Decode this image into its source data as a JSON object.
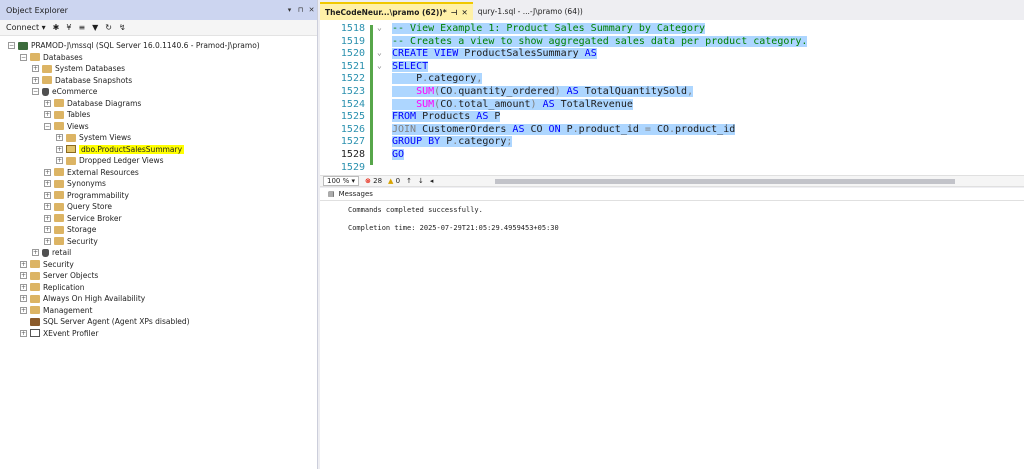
{
  "object_explorer": {
    "title": "Object Explorer",
    "controls": [
      "▾",
      "⊓",
      "✕"
    ],
    "toolbar": {
      "connect": "Connect ▾",
      "icons": [
        "✱",
        "¥",
        "≡",
        "▼",
        "↻",
        "↯"
      ]
    },
    "tree": [
      {
        "label": "PRAMOD-J\\mssql (SQL Server 16.0.1140.6 - Pramod-J\\pramo)",
        "exp": "−",
        "icon": "server"
      },
      {
        "label": "Databases",
        "exp": "−",
        "icon": "folder"
      },
      {
        "label": "System Databases",
        "exp": "+",
        "icon": "folder"
      },
      {
        "label": "Database Snapshots",
        "exp": "+",
        "icon": "folder"
      },
      {
        "label": "eCommerce",
        "exp": "−",
        "icon": "db"
      },
      {
        "label": "Database Diagrams",
        "exp": "+",
        "icon": "folder"
      },
      {
        "label": "Tables",
        "exp": "+",
        "icon": "folder"
      },
      {
        "label": "Views",
        "exp": "−",
        "icon": "folder"
      },
      {
        "label": "System Views",
        "exp": "+",
        "icon": "folder"
      },
      {
        "label": "dbo.ProductSalesSummary",
        "exp": "+",
        "icon": "view"
      },
      {
        "label": "Dropped Ledger Views",
        "exp": "+",
        "icon": "folder"
      },
      {
        "label": "External Resources",
        "exp": "+",
        "icon": "folder"
      },
      {
        "label": "Synonyms",
        "exp": "+",
        "icon": "folder"
      },
      {
        "label": "Programmability",
        "exp": "+",
        "icon": "folder"
      },
      {
        "label": "Query Store",
        "exp": "+",
        "icon": "folder"
      },
      {
        "label": "Service Broker",
        "exp": "+",
        "icon": "folder"
      },
      {
        "label": "Storage",
        "exp": "+",
        "icon": "folder"
      },
      {
        "label": "Security",
        "exp": "+",
        "icon": "folder"
      },
      {
        "label": "retail",
        "exp": "+",
        "icon": "db"
      },
      {
        "label": "Security",
        "exp": "+",
        "icon": "folder"
      },
      {
        "label": "Server Objects",
        "exp": "+",
        "icon": "folder"
      },
      {
        "label": "Replication",
        "exp": "+",
        "icon": "folder"
      },
      {
        "label": "Always On High Availability",
        "exp": "+",
        "icon": "folder"
      },
      {
        "label": "Management",
        "exp": "+",
        "icon": "folder"
      },
      {
        "label": "SQL Server Agent (Agent XPs disabled)",
        "exp": "",
        "icon": "agent"
      },
      {
        "label": "XEvent Profiler",
        "exp": "+",
        "icon": "xevent"
      }
    ]
  },
  "tabs": [
    {
      "label": "TheCodeNeur...\\pramo (62))*",
      "pin": "⊣",
      "close": "✕"
    },
    {
      "label": "qury-1.sql - ...-J\\pramo (64))"
    }
  ],
  "editor": {
    "lines": [
      {
        "n": "1518",
        "fold": "⌄",
        "segs": [
          [
            "cm",
            "-- View Example 1: Product Sales Summary by Category"
          ]
        ]
      },
      {
        "n": "1519",
        "fold": "",
        "segs": [
          [
            "cm",
            "-- Creates a view to show aggregated sales data per product category."
          ]
        ]
      },
      {
        "n": "1520",
        "fold": "⌄",
        "segs": [
          [
            "kw",
            "CREATE VIEW "
          ],
          [
            "",
            "ProductSalesSummary "
          ],
          [
            "kw",
            "AS"
          ]
        ]
      },
      {
        "n": "1521",
        "fold": "⌄",
        "segs": [
          [
            "kw",
            "SELECT"
          ]
        ]
      },
      {
        "n": "1522",
        "fold": "",
        "segs": [
          [
            "",
            "    P"
          ],
          [
            "gr",
            "."
          ],
          [
            "",
            "category"
          ],
          [
            "gr",
            ","
          ]
        ]
      },
      {
        "n": "1523",
        "fold": "",
        "segs": [
          [
            "fn",
            "    SUM"
          ],
          [
            "gr",
            "("
          ],
          [
            "",
            "CO"
          ],
          [
            "gr",
            "."
          ],
          [
            "",
            "quantity_ordered"
          ],
          [
            "gr",
            ") "
          ],
          [
            "kw",
            "AS "
          ],
          [
            "",
            "TotalQuantitySold"
          ],
          [
            "gr",
            ","
          ]
        ]
      },
      {
        "n": "1524",
        "fold": "",
        "segs": [
          [
            "fn",
            "    SUM"
          ],
          [
            "gr",
            "("
          ],
          [
            "",
            "CO"
          ],
          [
            "gr",
            "."
          ],
          [
            "",
            "total_amount"
          ],
          [
            "gr",
            ") "
          ],
          [
            "kw",
            "AS "
          ],
          [
            "",
            "TotalRevenue"
          ]
        ]
      },
      {
        "n": "1525",
        "fold": "",
        "segs": [
          [
            "kw",
            "FROM "
          ],
          [
            "",
            "Products "
          ],
          [
            "kw",
            "AS "
          ],
          [
            "",
            "P"
          ]
        ]
      },
      {
        "n": "1526",
        "fold": "",
        "segs": [
          [
            "gr",
            "JOIN "
          ],
          [
            "",
            "CustomerOrders "
          ],
          [
            "kw",
            "AS "
          ],
          [
            "",
            "CO "
          ],
          [
            "kw",
            "ON "
          ],
          [
            "",
            "P"
          ],
          [
            "gr",
            "."
          ],
          [
            "",
            "product_id "
          ],
          [
            "gr",
            "= "
          ],
          [
            "",
            "CO"
          ],
          [
            "gr",
            "."
          ],
          [
            "",
            "product_id"
          ]
        ]
      },
      {
        "n": "1527",
        "fold": "",
        "segs": [
          [
            "kw",
            "GROUP BY "
          ],
          [
            "",
            "P"
          ],
          [
            "gr",
            "."
          ],
          [
            "",
            "category"
          ],
          [
            "gr",
            ";"
          ]
        ]
      },
      {
        "n": "1528",
        "fold": "",
        "segs": [
          [
            "kw",
            "GO"
          ]
        ]
      },
      {
        "n": "1529",
        "fold": "",
        "segs": []
      }
    ]
  },
  "status": {
    "zoom": "100 %",
    "zoom_arrow": "▾",
    "errors": "28",
    "warnings": "0",
    "up": "↑",
    "down": "↓",
    "left": "◂"
  },
  "results": {
    "tab": "Messages",
    "line1": "Commands completed successfully.",
    "line2": "Completion time: 2025-07-29T21:05:29.4959453+05:30"
  }
}
